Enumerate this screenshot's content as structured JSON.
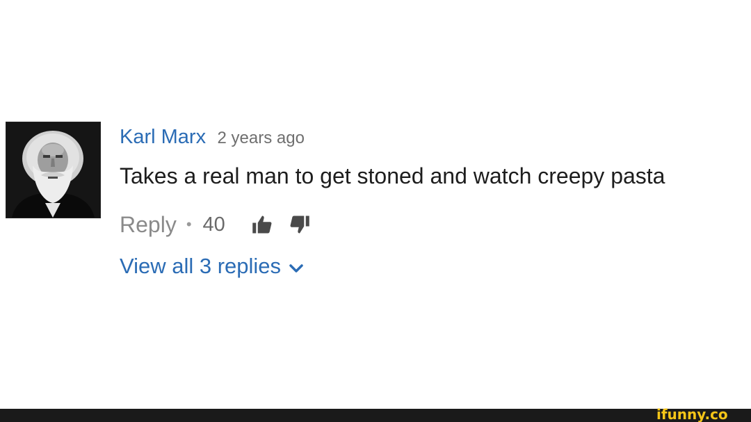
{
  "comment": {
    "author": "Karl Marx",
    "time": "2 years ago",
    "text": "Takes a real man to get stoned and watch creepy pasta",
    "reply_label": "Reply",
    "separator": "•",
    "likes": "40",
    "view_replies_label": "View all 3 replies",
    "icons": {
      "like": "thumbs-up-icon",
      "dislike": "thumbs-down-icon",
      "expand": "chevron-down-icon"
    }
  },
  "watermark": {
    "text": "ifunny.co"
  },
  "colors": {
    "link_blue": "#2b6cb5",
    "text_dark": "#1d1d1d",
    "text_muted": "#8a8a8a",
    "watermark_yellow": "#f5c518",
    "footer_bar": "#1a1a1a"
  }
}
